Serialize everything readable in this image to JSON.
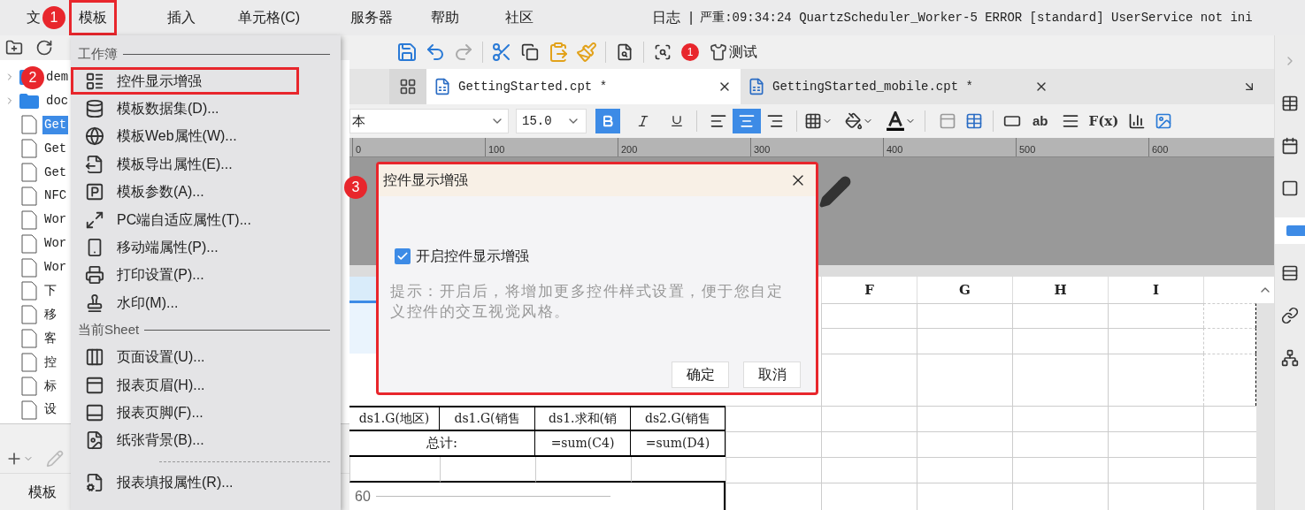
{
  "menubar": [
    {
      "label": "文",
      "highlighted": false
    },
    {
      "label": "模板",
      "highlighted": true
    },
    {
      "label": "插入",
      "highlighted": false
    },
    {
      "label": "单元格(C)",
      "highlighted": false
    },
    {
      "label": "服务器",
      "highlighted": false
    },
    {
      "label": "帮助",
      "highlighted": false
    },
    {
      "label": "社区",
      "highlighted": false
    }
  ],
  "log": {
    "label": "日志",
    "divider": "|",
    "text": "严重:09:34:24 QuartzScheduler_Worker-5 ERROR [standard] UserService not ini"
  },
  "badges": [
    "1",
    "2",
    "3"
  ],
  "file_tree": {
    "items": [
      {
        "label": "dem",
        "kind": "folder",
        "selected": false
      },
      {
        "label": "doc",
        "kind": "folder",
        "selected": false
      },
      {
        "label": "Get",
        "kind": "file",
        "selected": true
      },
      {
        "label": "Get",
        "kind": "file",
        "selected": false
      },
      {
        "label": "Get",
        "kind": "file",
        "selected": false
      },
      {
        "label": "NFC",
        "kind": "file",
        "selected": false
      },
      {
        "label": "Wor",
        "kind": "file",
        "selected": false
      },
      {
        "label": "Wor",
        "kind": "file",
        "selected": false
      },
      {
        "label": "Wor",
        "kind": "file",
        "selected": false
      },
      {
        "label": "下",
        "kind": "file",
        "selected": false
      },
      {
        "label": "移",
        "kind": "file",
        "selected": false
      },
      {
        "label": "客",
        "kind": "file",
        "selected": false
      },
      {
        "label": "控",
        "kind": "file",
        "selected": false
      },
      {
        "label": "标",
        "kind": "file",
        "selected": false
      },
      {
        "label": "设",
        "kind": "file",
        "selected": false
      }
    ],
    "bottom_label": "模板"
  },
  "menu": {
    "items": [
      {
        "kind": "section",
        "label": "工作簿"
      },
      {
        "kind": "item",
        "label": "控件显示增强",
        "highlighted": true
      },
      {
        "kind": "item",
        "label": "模板数据集(D)...",
        "highlighted": false
      },
      {
        "kind": "item",
        "label": "模板Web属性(W)...",
        "highlighted": false
      },
      {
        "kind": "item",
        "label": "模板导出属性(E)...",
        "highlighted": false
      },
      {
        "kind": "item",
        "label": "模板参数(A)...",
        "highlighted": false
      },
      {
        "kind": "item",
        "label": "PC端自适应属性(T)...",
        "highlighted": false
      },
      {
        "kind": "item",
        "label": "移动端属性(P)...",
        "highlighted": false
      },
      {
        "kind": "item",
        "label": "打印设置(P)...",
        "highlighted": false
      },
      {
        "kind": "item",
        "label": "水印(M)...",
        "highlighted": false
      },
      {
        "kind": "section",
        "label": "当前Sheet"
      },
      {
        "kind": "item",
        "label": "页面设置(U)...",
        "highlighted": false
      },
      {
        "kind": "item",
        "label": "报表页眉(H)...",
        "highlighted": false
      },
      {
        "kind": "item",
        "label": "报表页脚(F)...",
        "highlighted": false
      },
      {
        "kind": "item",
        "label": "纸张背景(B)...",
        "highlighted": false
      },
      {
        "kind": "separator"
      },
      {
        "kind": "item",
        "label": "报表填报属性(R)...",
        "highlighted": false
      }
    ]
  },
  "toolbar": {
    "notification_count": "1",
    "test_label": "测试"
  },
  "tabs": [
    {
      "label": "GettingStarted.cpt *",
      "selected": true
    },
    {
      "label": "GettingStarted_mobile.cpt *",
      "selected": false
    }
  ],
  "format": {
    "font": "本",
    "size": "15.0",
    "bold": true,
    "italic": false,
    "underline": false,
    "align": [
      {
        "kind": "left",
        "selected": false
      },
      {
        "kind": "center",
        "selected": true
      },
      {
        "kind": "right",
        "selected": false
      }
    ],
    "text_tool": "ab",
    "formula_tool": "F(x)"
  },
  "ruler": [
    "0",
    "100",
    "200",
    "300",
    "400",
    "500",
    "600"
  ],
  "sheet": {
    "column_headers": [
      "F",
      "G",
      "H",
      "I"
    ],
    "field_row": [
      "ds1.G(地区)",
      "ds1.G(销售",
      "ds1.求和(销",
      "ds2.G(销售"
    ],
    "total_row": {
      "label": "总计:",
      "values": [
        "=sum(C4)",
        "=sum(D4)"
      ]
    },
    "chart_tick": "60"
  },
  "dialog": {
    "title": "控件显示增强",
    "highlighted": true,
    "checkbox": {
      "label": "开启控件显示增强",
      "checked": true
    },
    "hint": "提示：开启后，将增加更多控件样式设置，便于您自定义控件的交互视觉风格。",
    "buttons": [
      "确定",
      "取消"
    ]
  }
}
